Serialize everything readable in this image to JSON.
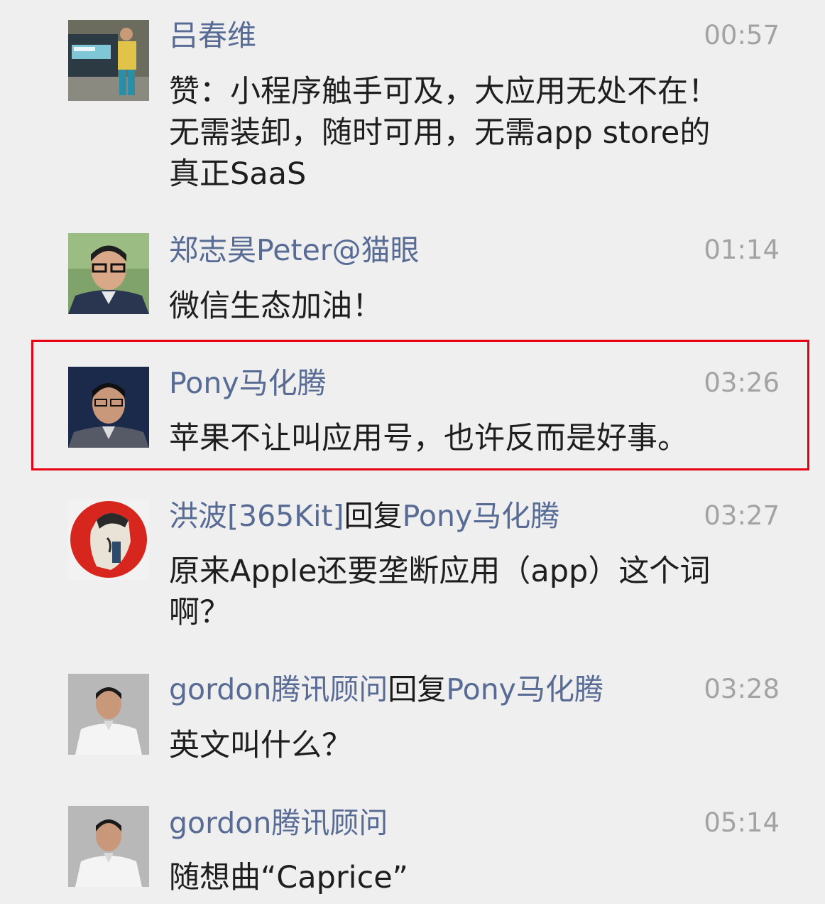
{
  "comments": [
    {
      "author": "吕春维",
      "time": "00:57",
      "text": "赞：小程序触手可及，大应用无处不在！\n无需装卸，随时可用，无需app store的\n真正SaaS"
    },
    {
      "author": "郑志昊Peter@猫眼",
      "time": "01:14",
      "text": "微信生态加油！"
    },
    {
      "author": "Pony马化腾",
      "time": "03:26",
      "text": "苹果不让叫应用号，也许反而是好事。"
    },
    {
      "author": "洪波[365Kit]",
      "reply_word": "回复",
      "reply_to": "Pony马化腾",
      "time": "03:27",
      "text": "原来Apple还要垄断应用（app）这个词\n啊？"
    },
    {
      "author": "gordon腾讯顾问",
      "reply_word": "回复",
      "reply_to": "Pony马化腾",
      "time": "03:28",
      "text": "英文叫什么？"
    },
    {
      "author": "gordon腾讯顾问",
      "time": "05:14",
      "text": "随想曲“Caprice”"
    }
  ],
  "highlight_color": "#e60012",
  "name_color": "#576b95"
}
